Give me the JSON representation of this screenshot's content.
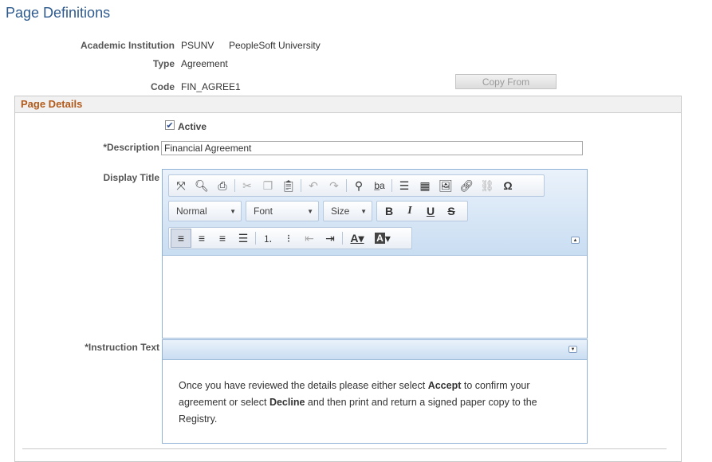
{
  "page": {
    "title": "Page Definitions"
  },
  "header_fields": {
    "institution_label": "Academic Institution",
    "institution_code": "PSUNV",
    "institution_name": "PeopleSoft University",
    "type_label": "Type",
    "type_value": "Agreement",
    "code_label": "Code",
    "code_value": "FIN_AGREE1",
    "copy_from_label": "Copy From"
  },
  "section": {
    "title": "Page Details",
    "active_label": "Active",
    "active_checked": true,
    "description_label": "*Description",
    "description_value": "Financial Agreement",
    "display_title_label": "Display Title",
    "instruction_label": "*Instruction Text"
  },
  "editor": {
    "format_value": "Normal",
    "font_value": "Font",
    "size_value": "Size",
    "row1_icons": [
      "maximize-icon",
      "preview-icon",
      "print-icon",
      "cut-icon",
      "copy-icon",
      "paste-icon",
      "undo-icon",
      "redo-icon",
      "find-icon",
      "replace-icon",
      "horizontal-line-icon",
      "table-icon",
      "image-icon",
      "link-icon",
      "unlink-icon",
      "special-char-icon"
    ],
    "row3_icons": [
      "align-left-icon",
      "align-center-icon",
      "align-right-icon",
      "justify-icon",
      "numbered-list-icon",
      "bullet-list-icon",
      "outdent-icon",
      "indent-icon",
      "text-color-icon",
      "background-color-icon"
    ]
  },
  "instruction": {
    "line1_pre": "Once you have reviewed the details please either select ",
    "accept": "Accept",
    "line1_post": " to confirm your agreement or select ",
    "decline": "Decline",
    "line2_post": " and then print and return a signed paper copy to the Registry."
  },
  "colors": {
    "title": "#2e5a8e",
    "section_title": "#b25a1a",
    "toolbar_top": "#eaf2fb",
    "toolbar_bottom": "#c9ddf2"
  }
}
